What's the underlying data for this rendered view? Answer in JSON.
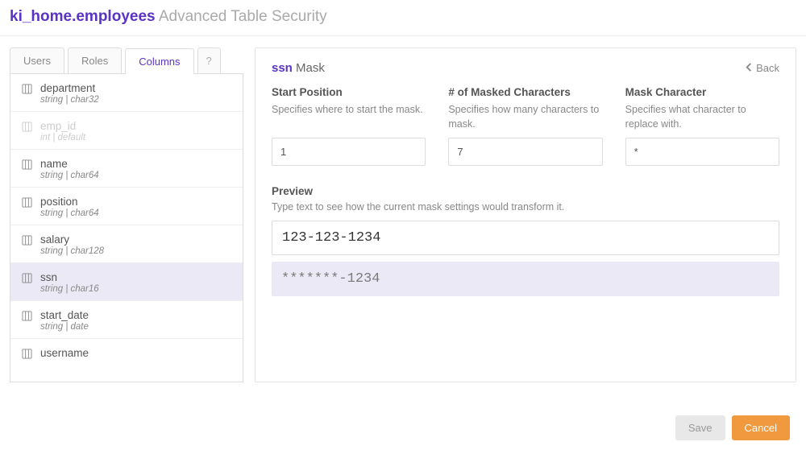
{
  "header": {
    "table_name": "ki_home.employees",
    "page_title": "Advanced Table Security"
  },
  "tabs": {
    "users": "Users",
    "roles": "Roles",
    "columns": "Columns",
    "help": "?"
  },
  "columns": [
    {
      "name": "department",
      "meta": "string | char32",
      "disabled": false,
      "selected": false
    },
    {
      "name": "emp_id",
      "meta": "int | default",
      "disabled": true,
      "selected": false
    },
    {
      "name": "name",
      "meta": "string | char64",
      "disabled": false,
      "selected": false
    },
    {
      "name": "position",
      "meta": "string | char64",
      "disabled": false,
      "selected": false
    },
    {
      "name": "salary",
      "meta": "string | char128",
      "disabled": false,
      "selected": false
    },
    {
      "name": "ssn",
      "meta": "string | char16",
      "disabled": false,
      "selected": true
    },
    {
      "name": "start_date",
      "meta": "string | date",
      "disabled": false,
      "selected": false
    },
    {
      "name": "username",
      "meta": "",
      "disabled": false,
      "selected": false
    }
  ],
  "mask_panel": {
    "column": "ssn",
    "suffix": "Mask",
    "back_label": "Back",
    "fields": {
      "start": {
        "label": "Start Position",
        "desc": "Specifies where to start the mask.",
        "value": "1"
      },
      "count": {
        "label": "# of Masked Characters",
        "desc": "Specifies how many characters to mask.",
        "value": "7"
      },
      "char": {
        "label": "Mask Character",
        "desc": "Specifies what character to replace with.",
        "value": "*"
      }
    },
    "preview": {
      "label": "Preview",
      "desc": "Type text to see how the current mask settings would transform it.",
      "input_value": "123-123-1234",
      "output_value": "*******-1234"
    }
  },
  "buttons": {
    "save": "Save",
    "cancel": "Cancel"
  }
}
